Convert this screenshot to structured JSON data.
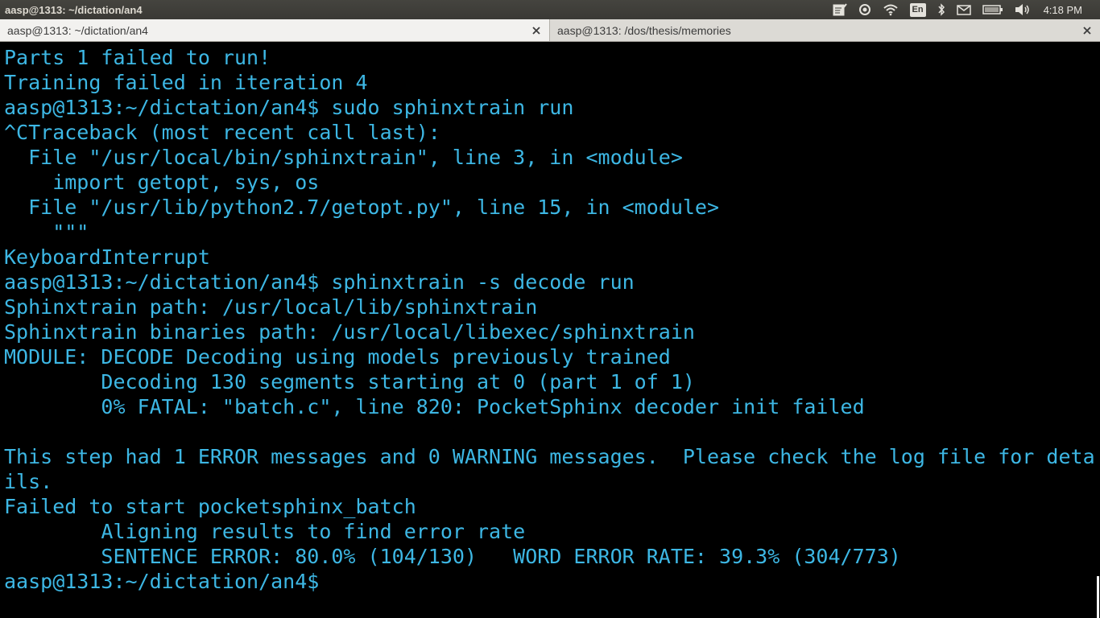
{
  "panel": {
    "window_title": "aasp@1313: ~/dictation/an4",
    "keyboard_layout": "En",
    "clock": "4:18 PM",
    "indicator_icons": [
      "notes-icon",
      "cloud-sync-icon",
      "wifi-icon",
      "keyboard-layout-icon",
      "bluetooth-icon",
      "mail-icon",
      "battery-icon",
      "volume-icon"
    ]
  },
  "tabs": [
    {
      "label": "aasp@1313: ~/dictation/an4",
      "active": true
    },
    {
      "label": "aasp@1313: /dos/thesis/memories",
      "active": false
    }
  ],
  "terminal": {
    "text_color": "#3db7e4",
    "background": "#000000",
    "lines": [
      "Parts 1 failed to run!",
      "Training failed in iteration 4",
      "aasp@1313:~/dictation/an4$ sudo sphinxtrain run",
      "^CTraceback (most recent call last):",
      "  File \"/usr/local/bin/sphinxtrain\", line 3, in <module>",
      "    import getopt, sys, os",
      "  File \"/usr/lib/python2.7/getopt.py\", line 15, in <module>",
      "    \"\"\"",
      "KeyboardInterrupt",
      "aasp@1313:~/dictation/an4$ sphinxtrain -s decode run",
      "Sphinxtrain path: /usr/local/lib/sphinxtrain",
      "Sphinxtrain binaries path: /usr/local/libexec/sphinxtrain",
      "MODULE: DECODE Decoding using models previously trained",
      "        Decoding 130 segments starting at 0 (part 1 of 1)",
      "        0% FATAL: \"batch.c\", line 820: PocketSphinx decoder init failed",
      "",
      "This step had 1 ERROR messages and 0 WARNING messages.  Please check the log file for deta",
      "ils.",
      "Failed to start pocketsphinx_batch",
      "        Aligning results to find error rate",
      "        SENTENCE ERROR: 80.0% (104/130)   WORD ERROR RATE: 39.3% (304/773)",
      "aasp@1313:~/dictation/an4$ "
    ]
  }
}
